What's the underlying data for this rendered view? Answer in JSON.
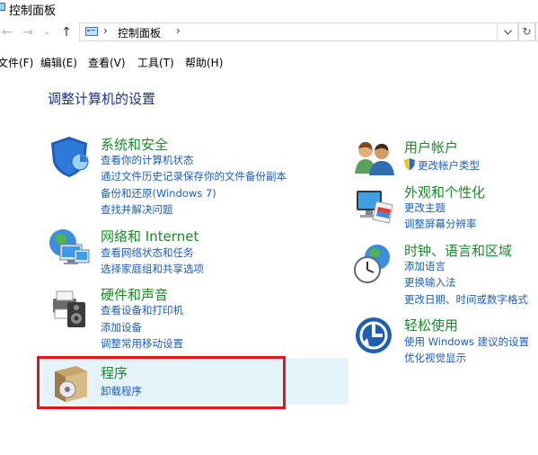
{
  "window": {
    "title": "控制面板"
  },
  "address": {
    "crumb": "控制面板"
  },
  "menu": [
    "文件(F)",
    "编辑(E)",
    "查看(V)",
    "工具(T)",
    "帮助(H)"
  ],
  "heading": "调整计算机的设置",
  "categories": {
    "system": {
      "title": "系统和安全",
      "links": [
        "查看你的计算机状态",
        "通过文件历史记录保存你的文件备份副本",
        "备份和还原(Windows 7)",
        "查找并解决问题"
      ]
    },
    "network": {
      "title": "网络和 Internet",
      "links": [
        "查看网络状态和任务",
        "选择家庭组和共享选项"
      ]
    },
    "hardware": {
      "title": "硬件和声音",
      "links": [
        "查看设备和打印机",
        "添加设备",
        "调整常用移动设置"
      ]
    },
    "programs": {
      "title": "程序",
      "links": [
        "卸载程序"
      ]
    },
    "users": {
      "title": "用户帐户",
      "links": [
        "更改帐户类型"
      ]
    },
    "appearance": {
      "title": "外观和个性化",
      "links": [
        "更改主题",
        "调整屏幕分辨率"
      ]
    },
    "clock": {
      "title": "时钟、语言和区域",
      "links": [
        "添加语言",
        "更换输入法",
        "更改日期、时间或数字格式"
      ]
    },
    "ease": {
      "title": "轻松使用",
      "links": [
        "使用 Windows 建议的设置",
        "优化视觉显示"
      ]
    }
  }
}
